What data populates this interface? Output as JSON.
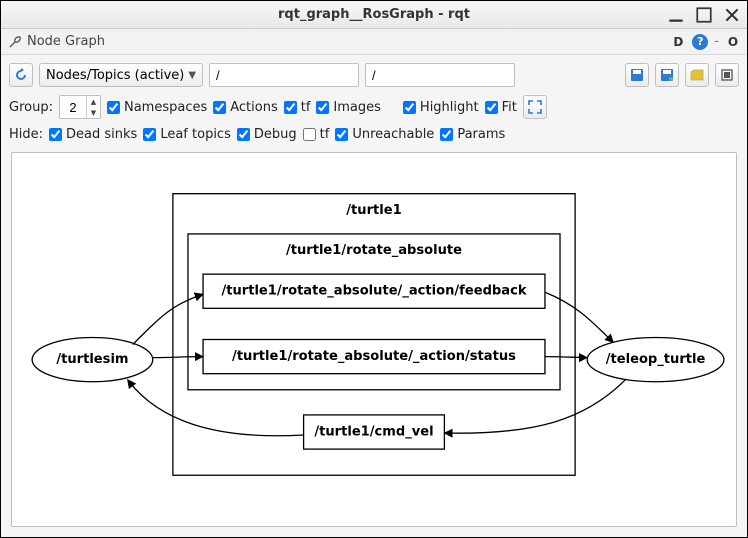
{
  "window": {
    "title": "rqt_graph__RosGraph - rqt"
  },
  "subheader": {
    "icon_name": "wrench-icon",
    "title": "Node Graph",
    "dock_letter": "D",
    "circle_letter": "O"
  },
  "toolbar": {
    "reload_icon": "refresh-icon",
    "combo_label": "Nodes/Topics (active)",
    "filter1": "/",
    "filter2": "/",
    "right_icons": [
      "save-icon",
      "save-all-icon",
      "load-icon",
      "settings-icon"
    ]
  },
  "group_row": {
    "label": "Group:",
    "value": "2",
    "namespaces_label": "Namespaces",
    "actions_label": "Actions",
    "tf_label": "tf",
    "images_label": "Images",
    "highlight_label": "Highlight",
    "fit_label": "Fit",
    "namespaces": true,
    "actions": true,
    "tf": true,
    "images": true,
    "highlight": true,
    "fit": true
  },
  "hide_row": {
    "label": "Hide:",
    "dead_sinks_label": "Dead sinks",
    "leaf_topics_label": "Leaf topics",
    "debug_label": "Debug",
    "tf_label": "tf",
    "unreachable_label": "Unreachable",
    "params_label": "Params",
    "dead_sinks": true,
    "leaf_topics": true,
    "debug": true,
    "tf": false,
    "unreachable": true,
    "params": true
  },
  "graph": {
    "cluster1_label": "/turtle1",
    "cluster2_label": "/turtle1/rotate_absolute",
    "topic_feedback": "/turtle1/rotate_absolute/_action/feedback",
    "topic_status": "/turtle1/rotate_absolute/_action/status",
    "topic_cmd_vel": "/turtle1/cmd_vel",
    "node_turtlesim": "/turtlesim",
    "node_teleop": "/teleop_turtle"
  }
}
